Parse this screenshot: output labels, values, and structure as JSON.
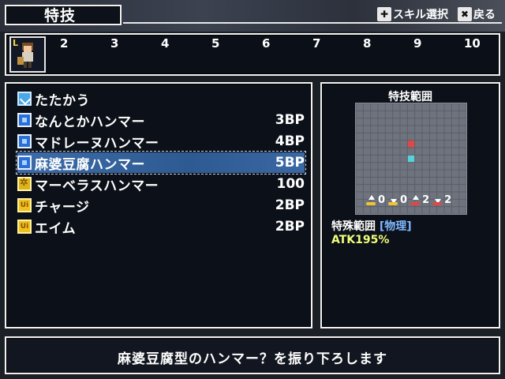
{
  "header": {
    "title": "特技",
    "hint_skill_select": "スキル選択",
    "hint_back": "戻る"
  },
  "party": {
    "slot1_level_label": "L",
    "slot_numbers": [
      "2",
      "3",
      "4",
      "5",
      "6",
      "7",
      "8",
      "9",
      "10"
    ]
  },
  "skills": [
    {
      "name": "たたかう",
      "cost": "",
      "icon": "attack-icon"
    },
    {
      "name": "なんとかハンマー",
      "cost": "3BP",
      "icon": "skill-icon"
    },
    {
      "name": "マドレーヌハンマー",
      "cost": "4BP",
      "icon": "skill-icon"
    },
    {
      "name": "麻婆豆腐ハンマー",
      "cost": "5BP",
      "icon": "skill-icon",
      "selected": true
    },
    {
      "name": "マーベラスハンマー",
      "cost": "100",
      "icon": "gear-icon"
    },
    {
      "name": "チャージ",
      "cost": "2BP",
      "icon": "ui-icon"
    },
    {
      "name": "エイム",
      "cost": "2BP",
      "icon": "ui-icon"
    }
  ],
  "range": {
    "title": "特技範囲",
    "stats": [
      "0",
      "0",
      "2",
      "2"
    ],
    "special_label": "特殊範囲",
    "type_tag": "物理",
    "atk": "ATK195%",
    "colors": {
      "target": "#e04848",
      "origin": "#5ad0d8"
    }
  },
  "message": {
    "text": "麻婆豆腐型のハンマー？を振り下ろします"
  }
}
